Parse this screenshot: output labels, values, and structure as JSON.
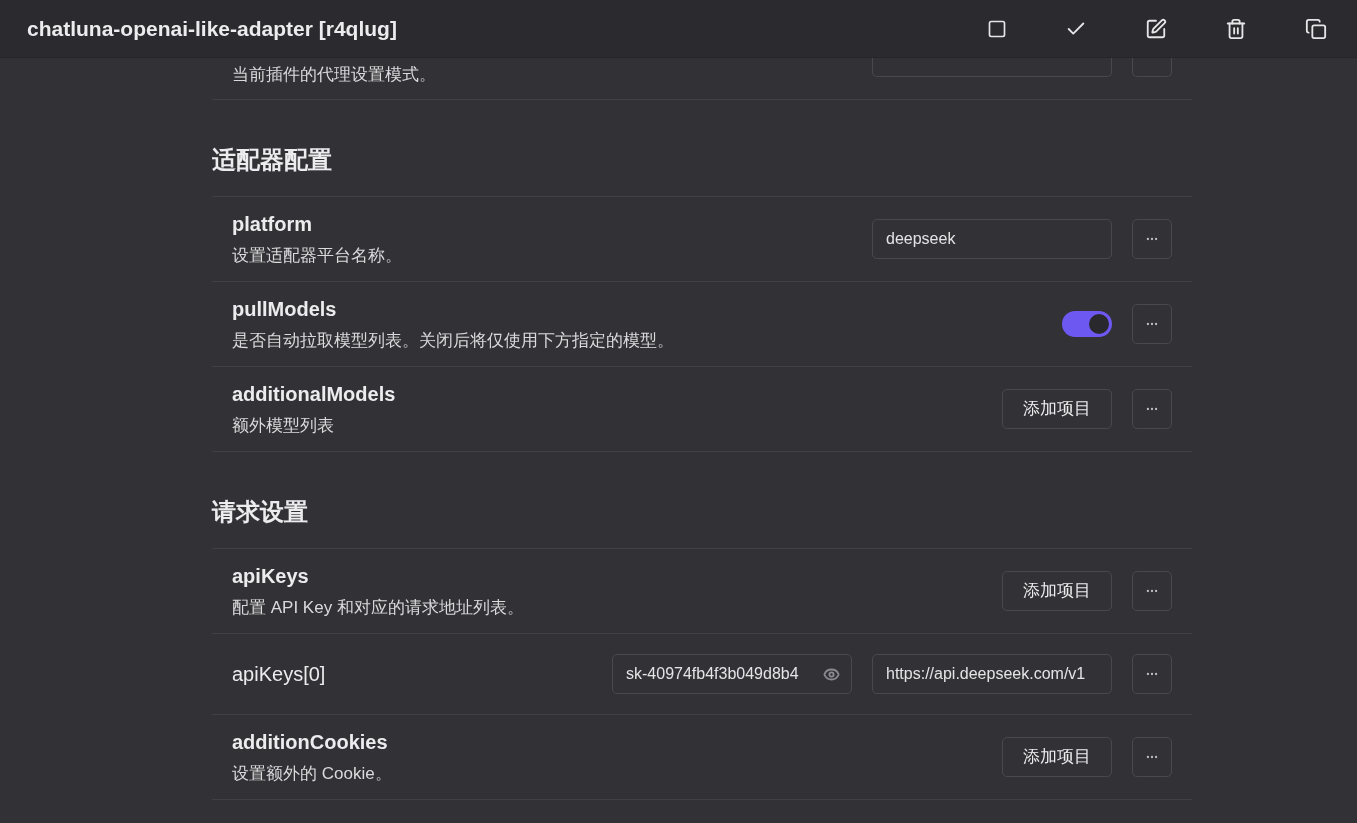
{
  "header": {
    "title": "chatluna-openai-like-adapter [r4qlug]"
  },
  "sections": [
    {
      "rows": [
        {
          "kind": "select",
          "description": "当前插件的代理设置模式。"
        }
      ]
    },
    {
      "title": "适配器配置",
      "rows": [
        {
          "kind": "text",
          "name": "platform",
          "description": "设置适配器平台名称。",
          "value": "deepseek"
        },
        {
          "kind": "switch",
          "name": "pullModels",
          "description": "是否自动拉取模型列表。关闭后将仅使用下方指定的模型。",
          "on": true
        },
        {
          "kind": "list",
          "name": "additionalModels",
          "description": "额外模型列表",
          "button": "添加项目"
        }
      ]
    },
    {
      "title": "请求设置",
      "rows": [
        {
          "kind": "list",
          "name": "apiKeys",
          "description": "配置 API Key 和对应的请求地址列表。",
          "button": "添加项目"
        },
        {
          "kind": "pair",
          "name": "apiKeys[0]",
          "secret": "sk-40974fb4f3b049d8b4",
          "value": "https://api.deepseek.com/v1"
        },
        {
          "kind": "list",
          "name": "additionCookies",
          "description": "设置额外的 Cookie。",
          "button": "添加项目"
        }
      ]
    }
  ]
}
